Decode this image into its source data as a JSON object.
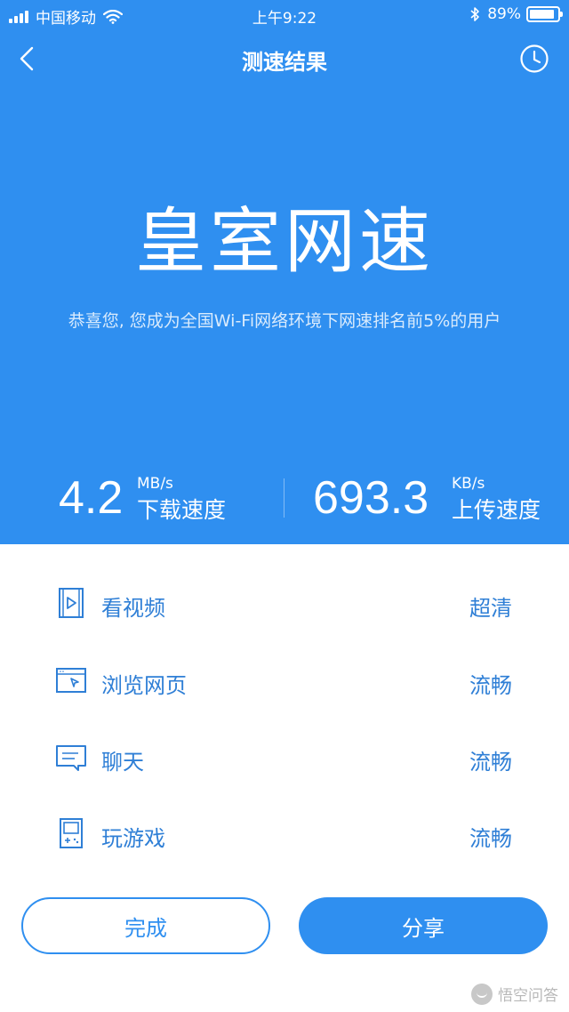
{
  "status_bar": {
    "carrier": "中国移动",
    "time": "上午9:22",
    "battery": "89%",
    "battery_level": 0.89
  },
  "nav": {
    "title": "测速结果",
    "back_icon": "chevron-left-icon",
    "history_icon": "clock-icon"
  },
  "result": {
    "headline": "皇室网速",
    "message": "恭喜您, 您成为全国Wi-Fi网络环境下网速排名前5%的用户"
  },
  "download": {
    "value": "4.2",
    "unit": "MB/s",
    "label": "下载速度"
  },
  "upload": {
    "value": "693.3",
    "unit": "KB/s",
    "label": "上传速度"
  },
  "usage": [
    {
      "icon": "video-icon",
      "label": "看视频",
      "quality": "超清"
    },
    {
      "icon": "browser-icon",
      "label": "浏览网页",
      "quality": "流畅"
    },
    {
      "icon": "chat-icon",
      "label": "聊天",
      "quality": "流畅"
    },
    {
      "icon": "gamepad-icon",
      "label": "玩游戏",
      "quality": "流畅"
    }
  ],
  "buttons": {
    "done": "完成",
    "share": "分享"
  },
  "watermark": {
    "text": "悟空问答"
  },
  "colors": {
    "primary": "#2f8ff0",
    "text_blue": "#2f7fd6"
  }
}
